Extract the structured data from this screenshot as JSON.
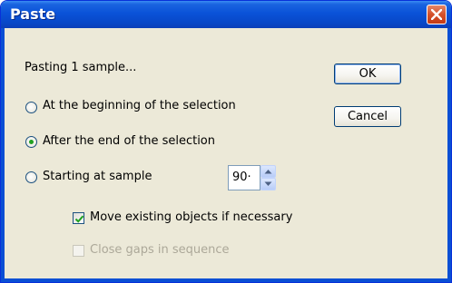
{
  "window": {
    "title": "Paste"
  },
  "status": {
    "text": "Pasting 1 sample..."
  },
  "buttons": {
    "ok": "OK",
    "cancel": "Cancel"
  },
  "options": {
    "beginning": {
      "label": "At the beginning of the selection",
      "selected": false
    },
    "after_end": {
      "label": "After the end of the selection",
      "selected": true
    },
    "starting_at": {
      "label": "Starting at sample",
      "selected": false
    }
  },
  "sample_field": {
    "value": "90·"
  },
  "checkboxes": {
    "move_objects": {
      "label": "Move existing objects if necessary",
      "checked": true,
      "enabled": true
    },
    "close_gaps": {
      "label": "Close gaps in sequence",
      "checked": false,
      "enabled": false
    }
  },
  "colors": {
    "titlebar": "#0a52d8",
    "dialog_bg": "#ece9d8",
    "close_button": "#c43b15",
    "radio_dot": "#21a121",
    "check_mark": "#21a121",
    "disabled_text": "#aca899"
  }
}
